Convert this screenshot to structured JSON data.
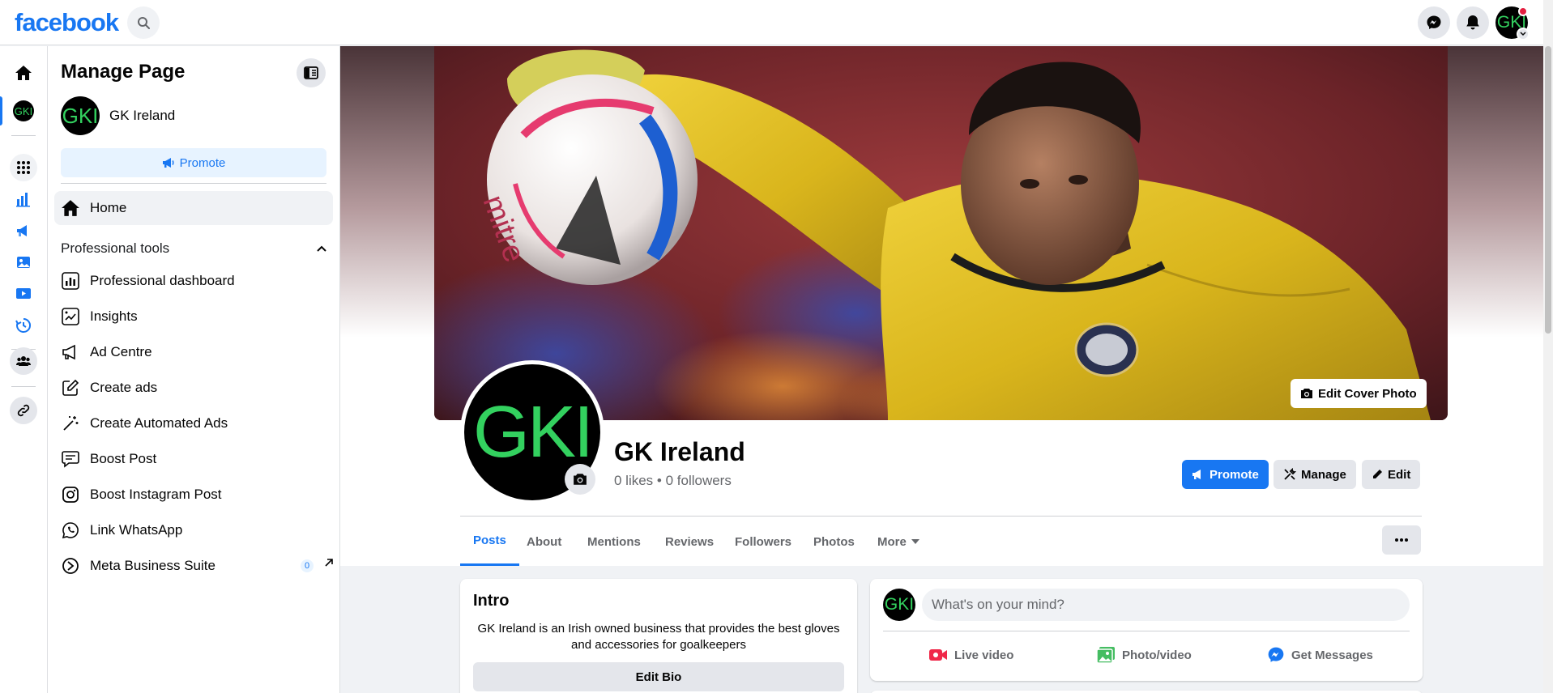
{
  "topbar": {
    "logo": "facebook",
    "search_icon": "search-icon",
    "messenger_icon": "messenger-icon",
    "notifications_icon": "bell-icon",
    "avatar_text": "GKI"
  },
  "rail": {
    "items": [
      "home-icon",
      "page-avatar",
      "apps-grid-icon",
      "insights-icon",
      "ads-icon",
      "content-icon",
      "video-icon",
      "history-icon",
      "people-icon",
      "link-icon"
    ],
    "page_avatar_text": "GKI"
  },
  "panel": {
    "title": "Manage Page",
    "page_avatar_text": "GKI",
    "page_name": "GK Ireland",
    "promote_label": "Promote",
    "home_label": "Home",
    "section_title": "Professional tools",
    "tools": [
      {
        "label": "Professional dashboard",
        "icon": "dashboard-icon"
      },
      {
        "label": "Insights",
        "icon": "insights-icon"
      },
      {
        "label": "Ad Centre",
        "icon": "megaphone-icon"
      },
      {
        "label": "Create ads",
        "icon": "pencil-square-icon"
      },
      {
        "label": "Create Automated Ads",
        "icon": "magic-wand-icon"
      },
      {
        "label": "Boost Post",
        "icon": "boost-post-icon"
      },
      {
        "label": "Boost Instagram Post",
        "icon": "instagram-icon"
      },
      {
        "label": "Link WhatsApp",
        "icon": "whatsapp-icon"
      },
      {
        "label": "Meta Business Suite",
        "icon": "meta-business-icon",
        "badge": "0"
      }
    ]
  },
  "profile": {
    "avatar_text": "GKI",
    "name": "GK Ireland",
    "stats": "0 likes • 0 followers",
    "edit_cover_label": "Edit Cover Photo",
    "promote_label": "Promote",
    "manage_label": "Manage",
    "edit_label": "Edit"
  },
  "tabs": [
    {
      "label": "Posts",
      "active": true
    },
    {
      "label": "About"
    },
    {
      "label": "Mentions"
    },
    {
      "label": "Reviews"
    },
    {
      "label": "Followers"
    },
    {
      "label": "Photos"
    },
    {
      "label": "More"
    }
  ],
  "intro": {
    "title": "Intro",
    "bio": "GK Ireland is an Irish owned business that provides the best gloves and accessories for goalkeepers",
    "edit_bio_label": "Edit Bio"
  },
  "composer": {
    "avatar_text": "GKI",
    "placeholder": "What's on your mind?",
    "actions": [
      {
        "label": "Live video",
        "icon": "live-video-icon"
      },
      {
        "label": "Photo/video",
        "icon": "photo-icon"
      },
      {
        "label": "Get Messages",
        "icon": "messenger-icon"
      }
    ]
  },
  "colors": {
    "brand": "#1877f2",
    "avatar_bg": "#000000",
    "avatar_text": "#33d15f",
    "live": "#f02849",
    "photo": "#45bd62"
  }
}
